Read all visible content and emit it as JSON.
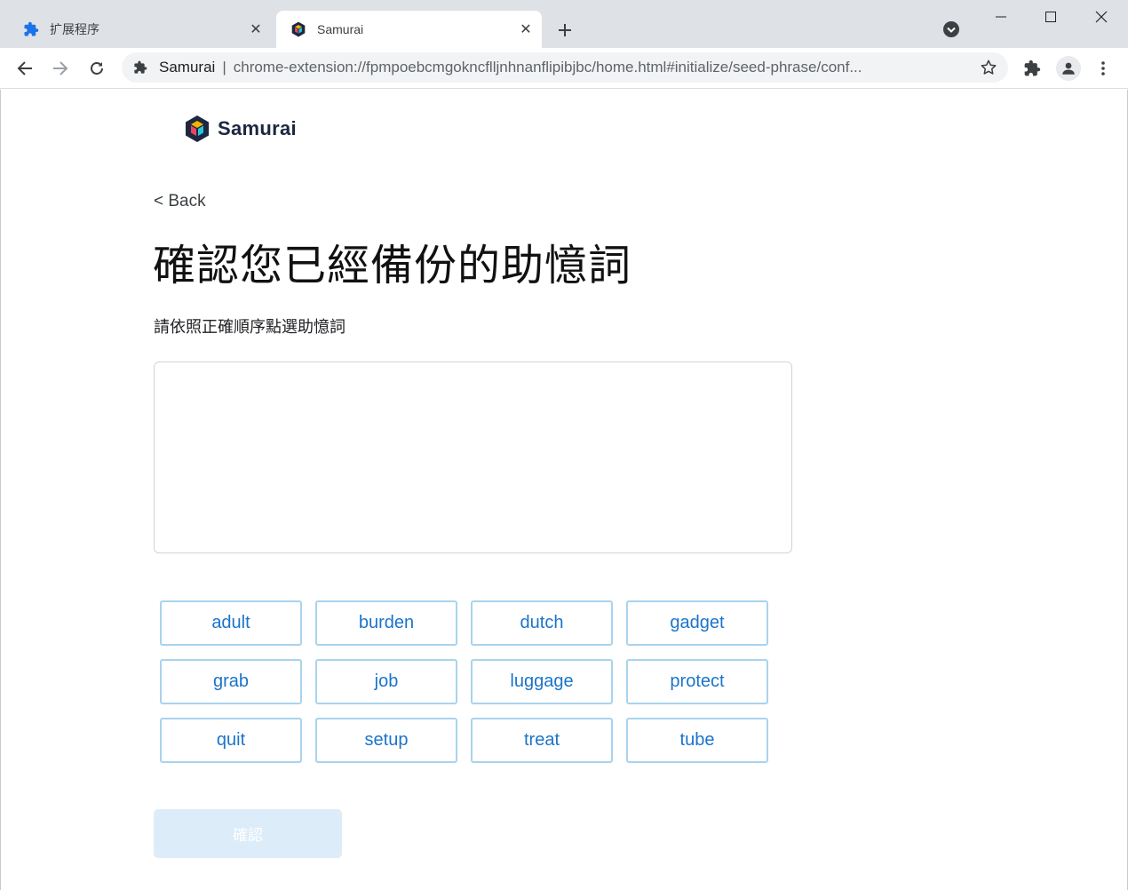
{
  "tabs": [
    {
      "title": "扩展程序",
      "favicon": "puzzle-icon",
      "active": false
    },
    {
      "title": "Samurai",
      "favicon": "samurai-logo-icon",
      "active": true
    }
  ],
  "omnibox": {
    "site_name": "Samurai",
    "separator": "|",
    "url": "chrome-extension://fpmpoebcmgokncflljnhnanflipibjbc/home.html#initialize/seed-phrase/conf..."
  },
  "page": {
    "brand": "Samurai",
    "back_label": "< Back",
    "title": "確認您已經備份的助憶詞",
    "subtitle": "請依照正確順序點選助憶詞",
    "words": [
      "adult",
      "burden",
      "dutch",
      "gadget",
      "grab",
      "job",
      "luggage",
      "protect",
      "quit",
      "setup",
      "treat",
      "tube"
    ],
    "confirm_label": "確認"
  },
  "colors": {
    "accent": "#1b74c9",
    "word_border": "#a9d3ef",
    "confirm_disabled_bg": "#dcecf9",
    "brand_text": "#1c2741"
  }
}
